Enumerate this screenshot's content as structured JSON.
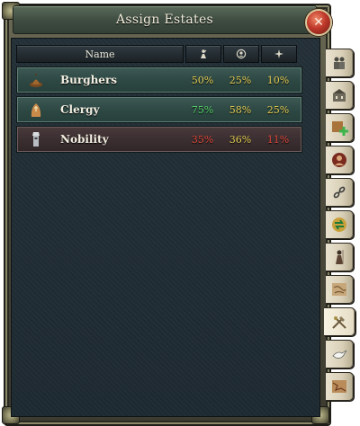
{
  "window": {
    "title": "Assign Estates",
    "close_icon": "close-x-icon"
  },
  "table": {
    "columns": [
      {
        "label": "Name",
        "icon": null
      },
      {
        "label": "",
        "icon": "influence-icon"
      },
      {
        "label": "",
        "icon": "loyalty-icon"
      },
      {
        "label": "",
        "icon": "land-share-icon"
      }
    ],
    "rows": [
      {
        "name": "Burghers",
        "icon": "burghers-icon",
        "values": [
          "50%",
          "25%",
          "10%"
        ],
        "colors": [
          "#e5cf55",
          "#e5cf55",
          "#e5cf55"
        ]
      },
      {
        "name": "Clergy",
        "icon": "clergy-icon",
        "values": [
          "75%",
          "58%",
          "25%"
        ],
        "colors": [
          "#57d46a",
          "#e5cf55",
          "#e5cf55"
        ]
      },
      {
        "name": "Nobility",
        "icon": "nobility-icon",
        "values": [
          "35%",
          "36%",
          "11%"
        ],
        "colors": [
          "#e04a3c",
          "#e5cf55",
          "#e04a3c"
        ]
      }
    ]
  },
  "side_tabs": [
    {
      "name": "army-tab-icon"
    },
    {
      "name": "buildings-tab-icon"
    },
    {
      "name": "add-province-tab-icon"
    },
    {
      "name": "portrait-tab-icon"
    },
    {
      "name": "chain-tab-icon"
    },
    {
      "name": "trade-tab-icon"
    },
    {
      "name": "soldier-tab-icon"
    },
    {
      "name": "map-tab-icon"
    },
    {
      "name": "estates-tab-icon",
      "active": true
    },
    {
      "name": "dove-tab-icon"
    },
    {
      "name": "province-map-tab-icon"
    }
  ],
  "colors": {
    "good": "#57d46a",
    "neutral": "#e5cf55",
    "bad": "#e04a3c"
  }
}
